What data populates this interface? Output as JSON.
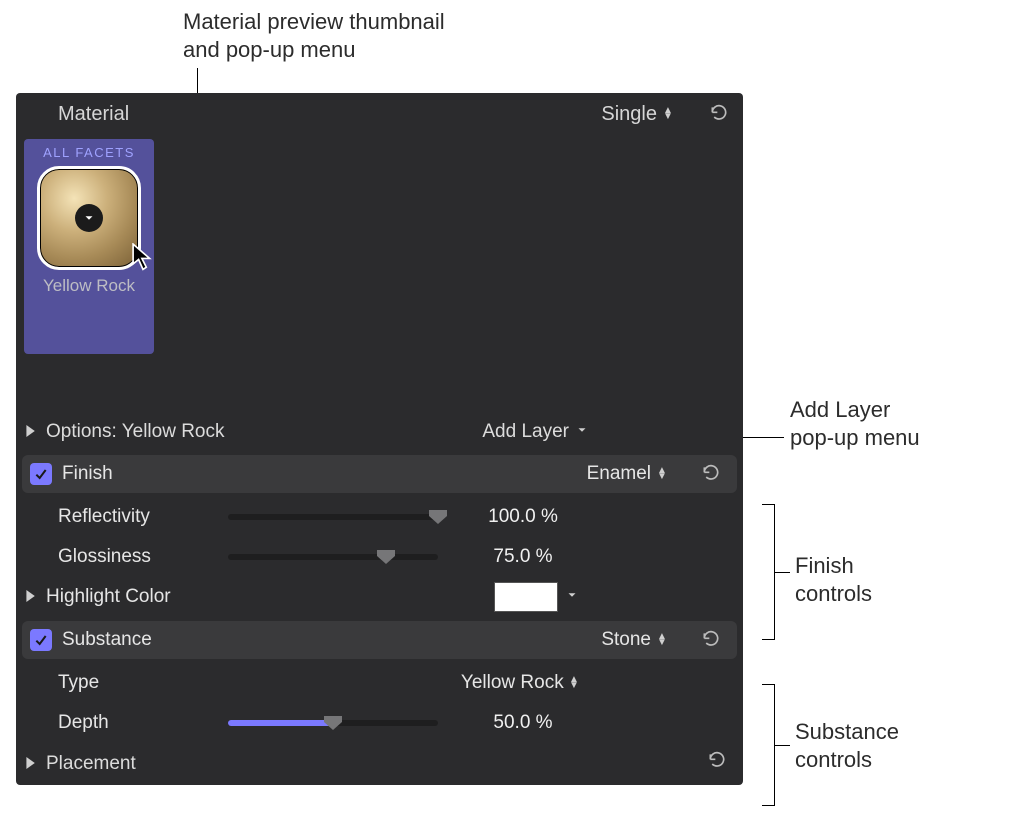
{
  "callouts": {
    "thumbnail": "Material preview thumbnail\nand pop-up menu",
    "add_layer": "Add Layer\npop-up menu",
    "finish_controls": "Finish\ncontrols",
    "substance_controls": "Substance\ncontrols"
  },
  "header": {
    "title": "Material",
    "mode": "Single"
  },
  "tile": {
    "facets_label": "ALL FACETS",
    "material_name": "Yellow Rock"
  },
  "options_row": {
    "label": "Options: Yellow Rock",
    "add_layer_label": "Add Layer"
  },
  "finish": {
    "label": "Finish",
    "value": "Enamel",
    "reflectivity": {
      "label": "Reflectivity",
      "value": "100.0  %",
      "pct": 100
    },
    "glossiness": {
      "label": "Glossiness",
      "value": "75.0  %",
      "pct": 75
    },
    "highlight": {
      "label": "Highlight Color",
      "hex": "#ffffff"
    }
  },
  "substance": {
    "label": "Substance",
    "value": "Stone",
    "type": {
      "label": "Type",
      "value": "Yellow Rock"
    },
    "depth": {
      "label": "Depth",
      "value": "50.0  %",
      "pct": 50
    }
  },
  "placement": {
    "label": "Placement"
  }
}
